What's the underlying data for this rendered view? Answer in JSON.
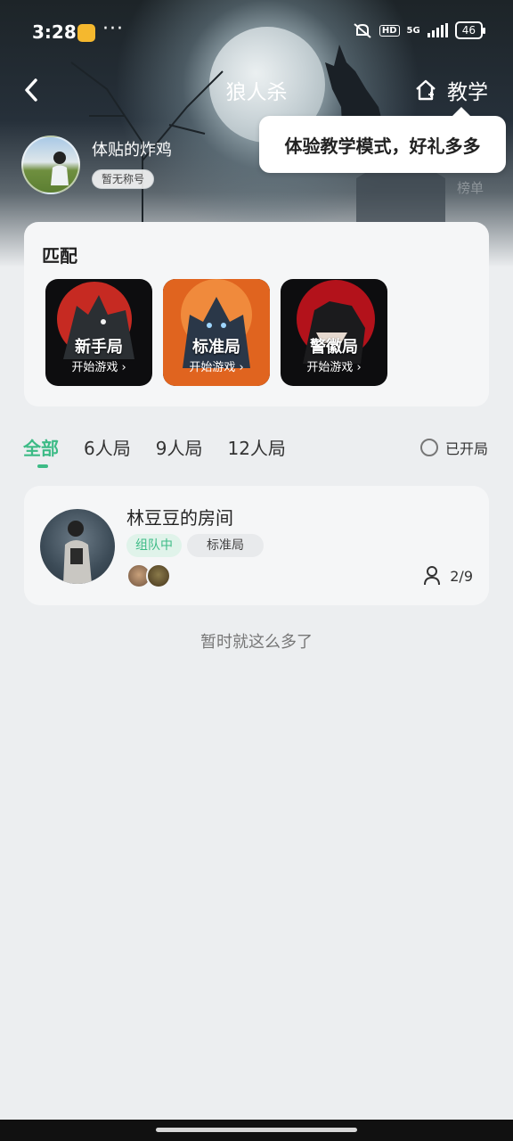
{
  "status_bar": {
    "time": "3:28",
    "more": "···",
    "hd": "HD",
    "network": "5G",
    "battery": "46"
  },
  "nav": {
    "title": "狼人杀",
    "teach_label": "教学"
  },
  "tooltip": {
    "text": "体验教学模式，好礼多多"
  },
  "profile": {
    "username": "体贴的炸鸡",
    "title_badge": "暂无称号",
    "rank_link": "榜单"
  },
  "match": {
    "heading": "匹配",
    "modes": [
      {
        "name": "新手局",
        "start": "开始游戏 ›",
        "color": "#c62a22"
      },
      {
        "name": "标准局",
        "start": "开始游戏 ›",
        "color": "#e0641f"
      },
      {
        "name": "警徽局",
        "start": "开始游戏 ›",
        "color": "#b3121b"
      }
    ]
  },
  "tabs": {
    "items": [
      "全部",
      "6人局",
      "9人局",
      "12人局"
    ],
    "active": "全部",
    "open_filter_label": "已开局"
  },
  "rooms": [
    {
      "name": "林豆豆的房间",
      "status_tag": "组队中",
      "mode_tag": "标准局",
      "count": "2/9"
    }
  ],
  "footer_note": "暂时就这么多了",
  "colors": {
    "accent": "#3dbb86",
    "card_bg": "#f5f6f7",
    "page_bg": "#eceef0"
  }
}
